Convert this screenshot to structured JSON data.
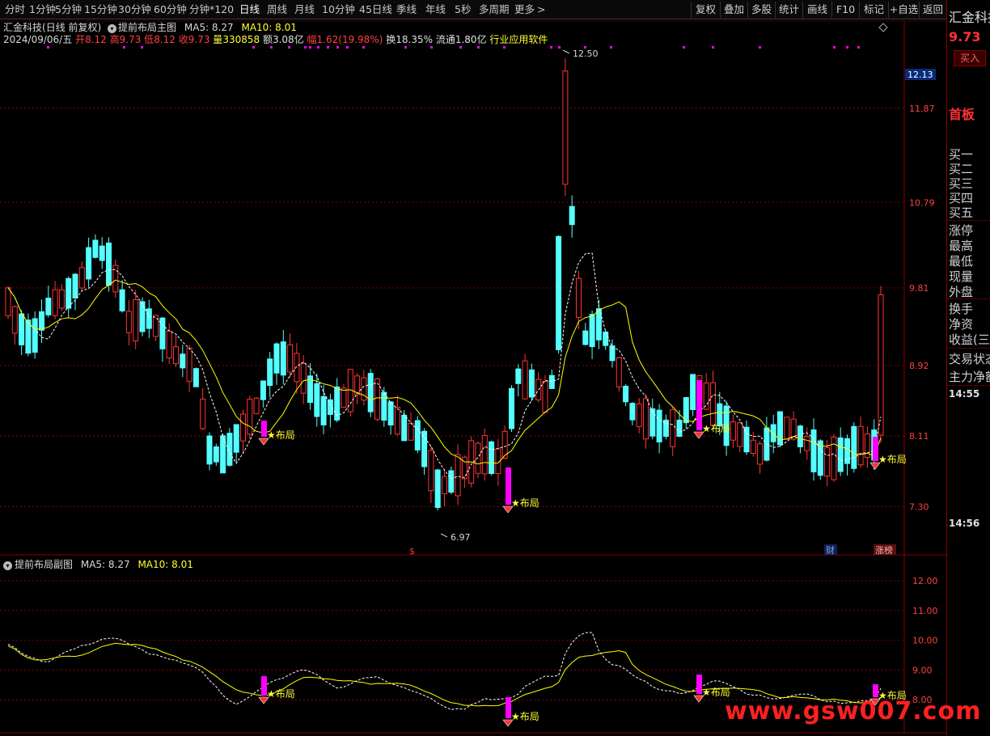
{
  "toolbar": {
    "periods": [
      "分时",
      "1分钟",
      "5分钟",
      "15分钟",
      "30分钟",
      "60分钟",
      "分钟*120",
      "日线",
      "周线",
      "月线",
      "10分钟",
      "45日线",
      "季线",
      "年线",
      "5秒",
      "多周期",
      "更多"
    ],
    "active_period": "日线",
    "more_icon": "chevron-right-icon",
    "tools": [
      "复权",
      "叠加",
      "多股",
      "统计",
      "画线",
      "F10",
      "标记",
      "+自选",
      "返回"
    ]
  },
  "main_chart": {
    "stock_name": "汇金科技",
    "mode": "(日线 前复权)",
    "indicator_name": "提前布局主图",
    "ma5_label": "MA5: 8.27",
    "ma10_label": "MA10: 8.01",
    "date": "2024/09/06/五",
    "open_label": "开",
    "open": "8.12",
    "high_label": "高",
    "high": "9.73",
    "low_label": "低",
    "low": "8.12",
    "close_label": "收",
    "close": "9.73",
    "volume_label": "量",
    "volume": "330858",
    "amount_label": "额",
    "amount": "3.08亿",
    "change_label": "幅",
    "change": "1.62(19.98%)",
    "turnover_label": "换",
    "turnover": "18.35%",
    "float_label": "流通",
    "float_cap": "1.80亿",
    "industry": "行业应用软件",
    "price_axis": [
      "11.87",
      "10.79",
      "9.81",
      "8.92",
      "8.11",
      "7.30"
    ],
    "current_price_tag": "12.13",
    "high_marker": "12.50",
    "low_marker": "6.97",
    "signal_text": "★布局",
    "event_markers": [
      "$",
      "财",
      "涨榜"
    ]
  },
  "sub_chart": {
    "indicator_name": "提前布局副图",
    "ma5_label": "MA5: 8.27",
    "ma10_label": "MA10: 8.01",
    "axis": [
      "12.00",
      "11.00",
      "10.00",
      "9.00",
      "8.00"
    ],
    "signal_text": "★布局"
  },
  "right_panel": {
    "name": "汇金科技",
    "price": "9.73",
    "buy_button": "买入",
    "board_tag": "首板",
    "orderbook": [
      "买一",
      "买二",
      "买三",
      "买四",
      "买五"
    ],
    "stats": [
      "涨停",
      "最高",
      "最低",
      "现量",
      "外盘"
    ],
    "stats2": [
      "换手",
      "净资",
      "收益(三)"
    ],
    "sections": [
      "交易状态",
      "主力净额"
    ],
    "times": [
      "14:55",
      "14:56"
    ]
  },
  "watermark": "www.gsw007.com",
  "colors": {
    "up": "#ff3333",
    "down": "#54ffff",
    "ma5": "#ffffff",
    "ma10": "#ffff00",
    "signal": "#ff00ff",
    "grid": "#8b0000"
  }
}
